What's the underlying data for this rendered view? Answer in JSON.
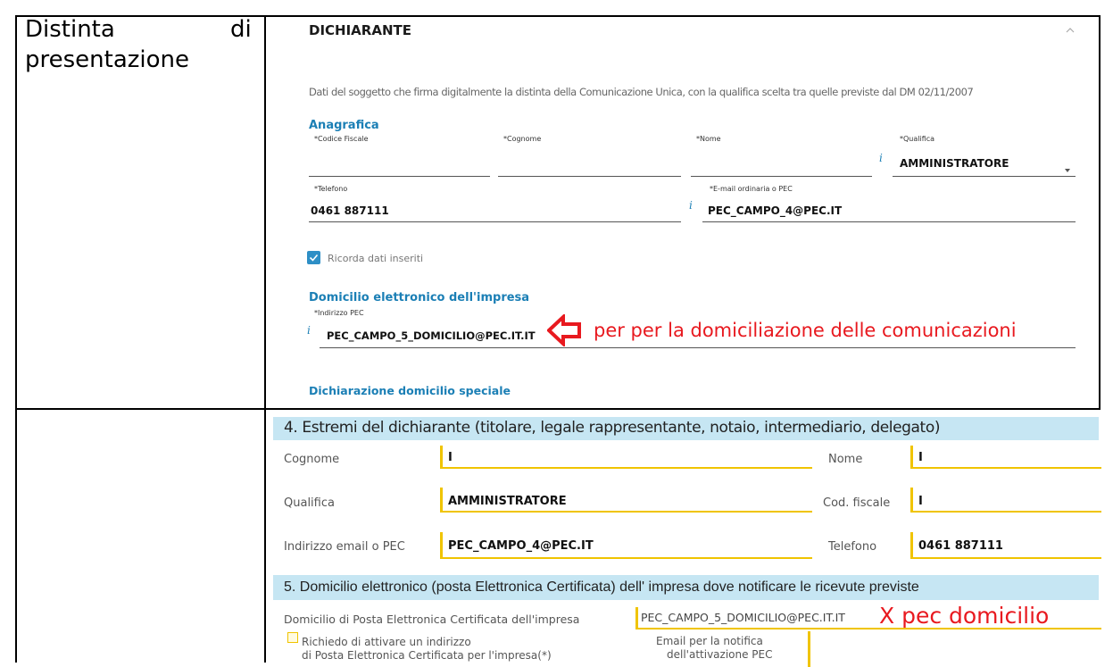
{
  "left_label": {
    "line1": "Distinta",
    "line1b": "di",
    "line2": "presentazione"
  },
  "panel": {
    "title": "DICHIARANTE",
    "description": "Dati del soggetto che firma digitalmente la distinta della Comunicazione Unica, con la qualifica scelta tra quelle previste dal DM 02/11/2007",
    "anagrafica": "Anagrafica",
    "codice_fiscale_label": "*Codice Fiscale",
    "cognome_label": "*Cognome",
    "nome_label": "*Nome",
    "qualifica_label": "*Qualifica",
    "qualifica_value": "AMMINISTRATORE",
    "telefono_label": "*Telefono",
    "telefono_value": "0461 887111",
    "email_label": "*E-mail ordinaria o PEC",
    "email_value": "PEC_CAMPO_4@PEC.IT",
    "ricorda_label": "Ricorda dati inseriti",
    "domicilio_title": "Domicilio elettronico dell'impresa",
    "pec_label": "*Indirizzo PEC",
    "pec_value": "PEC_CAMPO_5_DOMICILIO@PEC.IT.IT",
    "annotation": "per per la domiciliazione delle comunicazioni",
    "domicilio_speciale": "Dichiarazione domicilio speciale",
    "info_glyph": "i"
  },
  "form": {
    "section4": "4. Estremi del dichiarante (titolare, legale rappresentante, notaio, intermediario, delegato)",
    "cognome_label": "Cognome",
    "cognome_value": "I",
    "nome_label": "Nome",
    "nome_value": "I",
    "qualifica_label": "Qualifica",
    "qualifica_value": "AMMINISTRATORE",
    "codfiscale_label": "Cod. fiscale",
    "codfiscale_value": "I",
    "email_label": "Indirizzo email o PEC",
    "email_value": "PEC_CAMPO_4@PEC.IT",
    "telefono_label": "Telefono",
    "telefono_value": "0461 887111",
    "section5": "5. Domicilio elettronico (posta Elettronica Certificata) dell' impresa dove notificare le ricevute previste",
    "domicilio_label": "Domicilio di Posta Elettronica Certificata dell'impresa",
    "domicilio_value": "PEC_CAMPO_5_DOMICILIO@PEC.IT.IT",
    "annotation": "X pec domicilio",
    "richiedo_line1": "Richiedo di attivare un indirizzo",
    "richiedo_line2": "di Posta Elettronica Certificata per l'impresa(*)",
    "notifica_line1": "Email per la notifica",
    "notifica_line2": "dell'attivazione PEC"
  },
  "colors": {
    "accent_blue": "#1b7fb5",
    "annotation_red": "#e8191f",
    "field_yellow": "#f0c400",
    "section_bar": "#c6e6f3"
  }
}
